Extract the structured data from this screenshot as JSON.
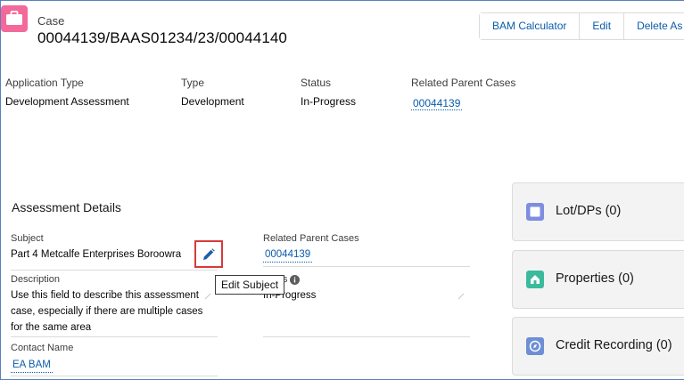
{
  "header": {
    "object_label": "Case",
    "record_title": "00044139/BAAS01234/23/00044140",
    "actions": [
      "BAM Calculator",
      "Edit",
      "Delete As"
    ]
  },
  "highlights": [
    {
      "label": "Application Type",
      "value": "Development Assessment"
    },
    {
      "label": "Type",
      "value": "Development"
    },
    {
      "label": "Status",
      "value": "In-Progress"
    },
    {
      "label": "Related Parent Cases",
      "link": "00044139"
    }
  ],
  "assessment_details": {
    "title": "Assessment Details",
    "subject_label": "Subject",
    "subject_value": "Part 4 Metcalfe Enterprises Boroowra",
    "related_label": "Related Parent Cases",
    "related_link": "00044139",
    "description_label": "Description",
    "description_lines": [
      "Use this field to describe this assessment",
      "case, especially if there are multiple cases",
      "for the same area"
    ],
    "status_label_partial": "s",
    "status_value": "In-Progress",
    "contact_label": "Contact Name",
    "contact_link": "EA BAM",
    "tooltip": "Edit Subject"
  },
  "related_cards": [
    {
      "title": "Lot/DPs (0)",
      "icon": "lot-icon",
      "color": "#7f8de1"
    },
    {
      "title": "Properties (0)",
      "icon": "properties-icon",
      "color": "#3bba9c"
    },
    {
      "title": "Credit Recording (0)",
      "icon": "credit-icon",
      "color": "#6c8fd5"
    }
  ]
}
